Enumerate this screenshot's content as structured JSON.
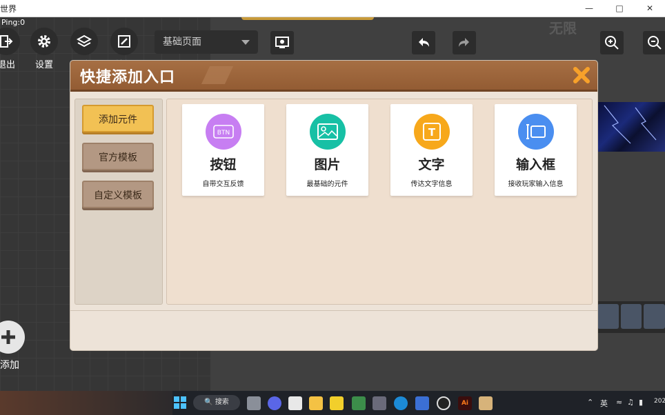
{
  "window": {
    "title": "世界"
  },
  "editor": {
    "ping": "Ping:0",
    "toolbar": [
      {
        "label": "退出",
        "icon": "exit-icon"
      },
      {
        "label": "设置",
        "icon": "gear-icon"
      },
      {
        "label": "层级",
        "icon": "layers-icon"
      },
      {
        "label": "编辑",
        "icon": "edit-icon"
      }
    ],
    "page_select": {
      "value": "基础页面"
    },
    "watermark": "无限",
    "add_label": "添加"
  },
  "modal": {
    "title": "快捷添加入口",
    "sidebar": [
      {
        "label": "添加元件",
        "active": true
      },
      {
        "label": "官方模板",
        "active": false
      },
      {
        "label": "自定义模板",
        "active": false
      }
    ],
    "cards": [
      {
        "name": "按钮",
        "desc": "自带交互反馈",
        "icon": "button-icon",
        "color": "#c77ef2",
        "glyph": "BTN"
      },
      {
        "name": "图片",
        "desc": "最基础的元件",
        "icon": "image-icon",
        "color": "#17c0a5",
        "glyph": ""
      },
      {
        "name": "文字",
        "desc": "传达文字信息",
        "icon": "text-icon",
        "color": "#f7a81b",
        "glyph": "T"
      },
      {
        "name": "输入框",
        "desc": "接收玩家输入信息",
        "icon": "input-icon",
        "color": "#4a8ef0",
        "glyph": ""
      }
    ]
  },
  "taskbar": {
    "search": "搜索",
    "lang": "英",
    "clock": "202"
  }
}
